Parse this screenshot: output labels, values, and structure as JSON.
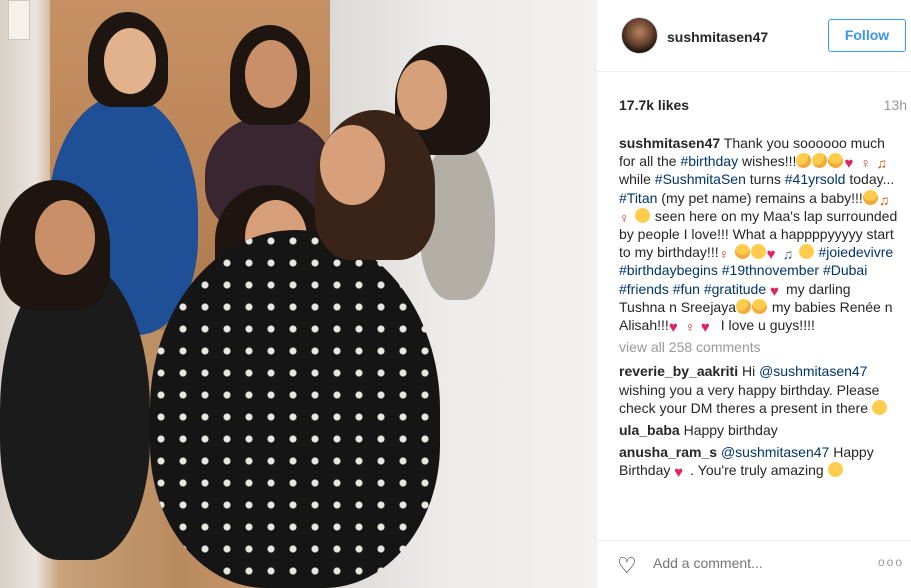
{
  "post": {
    "username": "sushmitasen47",
    "follow_label": "Follow",
    "likes": "17.7k likes",
    "time": "13h",
    "view_all": "view all 258 comments",
    "add_comment_placeholder": "Add a comment...",
    "more_label": "ooo"
  },
  "comments": [
    {
      "user": "sushmitasen47",
      "parts": [
        {
          "t": " Thank you soooooo much for all the "
        },
        {
          "tag": "#birthday"
        },
        {
          "t": " wishes!!!"
        },
        {
          "emoji": "kiss"
        },
        {
          "emoji": "kiss"
        },
        {
          "emoji": "heart-eyes"
        },
        {
          "emoji": "heart"
        },
        {
          "emoji": "dance"
        },
        {
          "emoji": "party"
        },
        {
          "t": " while "
        },
        {
          "tag": "#SushmitaSen"
        },
        {
          "t": " turns "
        },
        {
          "tag": "#41yrsold"
        },
        {
          "t": " today... "
        },
        {
          "tag": "#Titan"
        },
        {
          "t": " (my pet name) remains a baby!!!"
        },
        {
          "emoji": "heart-eyes"
        },
        {
          "emoji": "party"
        },
        {
          "emoji": "dance"
        },
        {
          "emoji": "smile"
        },
        {
          "t": " seen here on my Maa's lap surrounded by people I love!!! What a happppyyyyy start to my birthday!!!"
        },
        {
          "emoji": "dance"
        },
        {
          "emoji": "heart-eyes"
        },
        {
          "emoji": "smile"
        },
        {
          "emoji": "heart"
        },
        {
          "emoji": "music"
        },
        {
          "emoji": "grin"
        },
        {
          "t": " "
        },
        {
          "tag": "#joiedevivre"
        },
        {
          "t": " "
        },
        {
          "tag": "#birthdaybegins"
        },
        {
          "t": " "
        },
        {
          "tag": "#19thnovember"
        },
        {
          "t": " "
        },
        {
          "tag": "#Dubai"
        },
        {
          "t": " "
        },
        {
          "tag": "#friends"
        },
        {
          "t": " "
        },
        {
          "tag": "#fun"
        },
        {
          "t": " "
        },
        {
          "tag": "#gratitude"
        },
        {
          "t": " "
        },
        {
          "emoji": "heart"
        },
        {
          "t": "my darling Tushna n Sreejaya"
        },
        {
          "emoji": "kiss"
        },
        {
          "emoji": "heart-eyes"
        },
        {
          "t": " my babies Renée n Alisah!!!"
        },
        {
          "emoji": "heart"
        },
        {
          "emoji": "dance"
        },
        {
          "emoji": "heart"
        },
        {
          "t": " I love u guys!!!!"
        }
      ]
    },
    {
      "user": "reverie_by_aakriti",
      "parts": [
        {
          "t": " Hi "
        },
        {
          "tag": "@sushmitasen47"
        },
        {
          "t": " wishing you a very happy birthday. Please check your DM theres a present in there "
        },
        {
          "emoji": "smile"
        }
      ]
    },
    {
      "user": "ula_baba",
      "parts": [
        {
          "t": " Happy birthday"
        }
      ]
    },
    {
      "user": "anusha_ram_s",
      "parts": [
        {
          "t": " "
        },
        {
          "tag": "@sushmitasen47"
        },
        {
          "t": " Happy Birthday "
        },
        {
          "emoji": "broken"
        },
        {
          "t": ". You're truly amazing "
        },
        {
          "emoji": "smile"
        }
      ]
    }
  ],
  "emoji_glyphs": {
    "kiss": "",
    "heart": "♥",
    "dance": "♀",
    "party": "♫",
    "heart-eyes": "",
    "smile": "",
    "music": "♫",
    "grin": "",
    "broken": "♥"
  },
  "colors": {
    "follow": "#3897f0",
    "tag": "#003569",
    "muted": "#999999"
  }
}
